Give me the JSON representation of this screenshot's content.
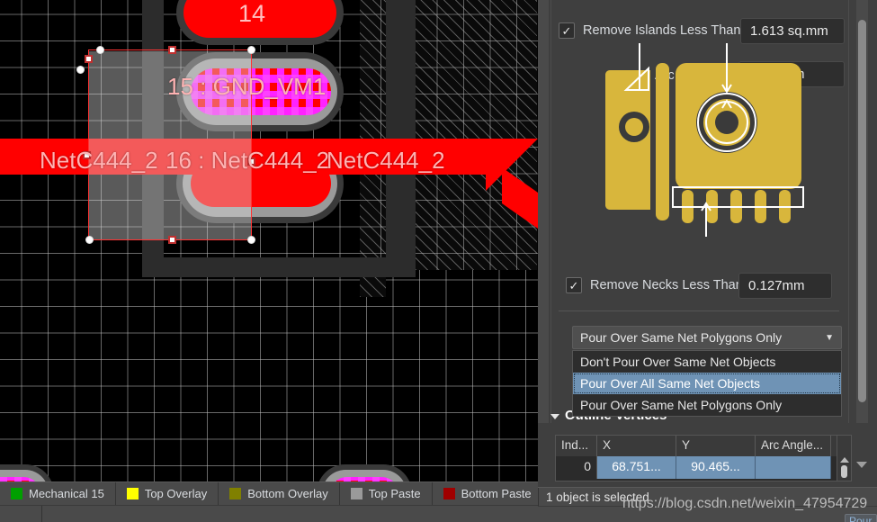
{
  "canvas": {
    "pads": [
      {
        "number": "14",
        "label": "14"
      },
      {
        "number": "15",
        "label": "15 : GND_VM1"
      },
      {
        "number": "16",
        "label": "16 : NetC444_2"
      }
    ],
    "net_labels": [
      "NetC444_2",
      "NetC444_2"
    ],
    "layer_tabs": [
      {
        "label": "Mechanical 15",
        "color": "#00a000"
      },
      {
        "label": "Top Overlay",
        "color": "#ffff00"
      },
      {
        "label": "Bottom Overlay",
        "color": "#808000"
      },
      {
        "label": "Top Paste",
        "color": "#9a9a9a"
      },
      {
        "label": "Bottom Paste",
        "color": "#a00000"
      }
    ]
  },
  "panel": {
    "remove_islands": {
      "label": "Remove Islands Less Than",
      "value": "1.613 sq.mm",
      "checked": "✓"
    },
    "arc_approx": {
      "label": "Arc Approx.",
      "value": "0.013mm"
    },
    "remove_necks": {
      "label": "Remove Necks Less Than",
      "value": "0.127mm",
      "checked": "✓"
    },
    "pour_combo": {
      "value": "Pour Over Same Net Polygons Only",
      "arrow": "▼",
      "options": [
        "Don't Pour Over Same Net Objects",
        "Pour Over All Same Net Objects",
        "Pour Over Same Net Polygons Only"
      ],
      "highlighted_index": 1
    },
    "outline_vertices": {
      "title": "Outline Vertices",
      "columns": [
        "Ind...",
        "X",
        "Y",
        "Arc Angle..."
      ],
      "rows": [
        {
          "index": "0",
          "x": "68.751...",
          "y": "90.465...",
          "arc": ""
        }
      ]
    }
  },
  "status": {
    "text": "1 object is selected"
  },
  "watermark": {
    "text": "https://blog.csdn.net/weixin_47954729"
  },
  "corner": {
    "label": "Pour"
  },
  "colors": {
    "accent_select": "#6f93b5",
    "panel_bg": "#3f3f3f",
    "field_bg": "#2e2e2e",
    "track_red": "#ff0000",
    "illustration_gold": "#d8b63c"
  }
}
